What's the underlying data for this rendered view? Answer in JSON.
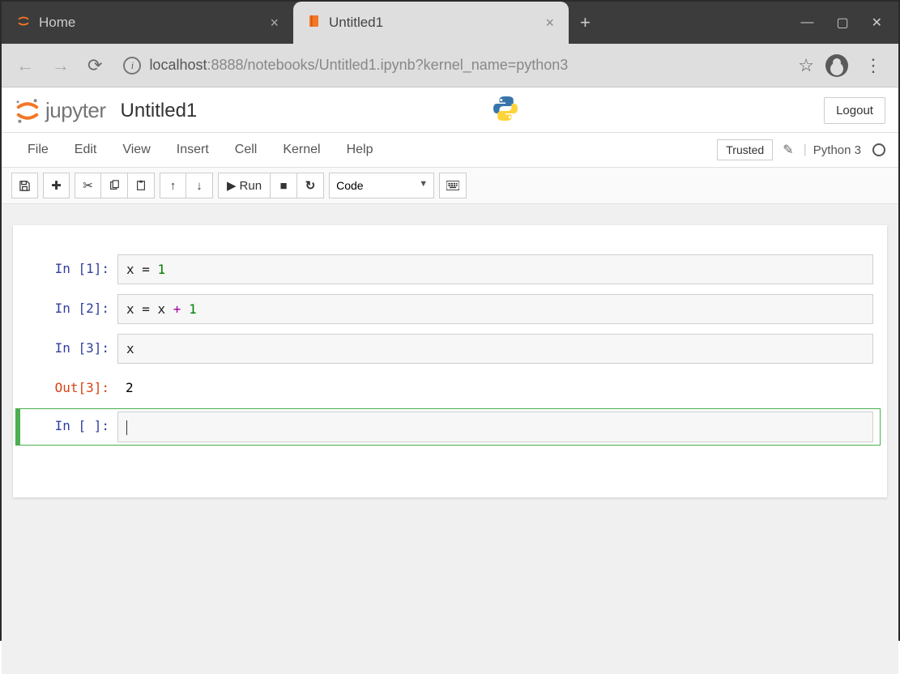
{
  "browser": {
    "tabs": {
      "inactive": {
        "title": "Home"
      },
      "active": {
        "title": "Untitled1"
      }
    },
    "url_host": "localhost",
    "url_port": ":8888",
    "url_path": "/notebooks/Untitled1.ipynb?kernel_name=python3"
  },
  "header": {
    "logo_text": "jupyter",
    "notebook_title": "Untitled1",
    "logout": "Logout"
  },
  "menubar": {
    "items": [
      "File",
      "Edit",
      "View",
      "Insert",
      "Cell",
      "Kernel",
      "Help"
    ],
    "trusted": "Trusted",
    "kernel_name": "Python 3"
  },
  "toolbar": {
    "run_label": "Run",
    "cell_type": "Code"
  },
  "cells": [
    {
      "prompt": "In [1]:",
      "code_html": "x = <span class='cm-num'>1</span>"
    },
    {
      "prompt": "In [2]:",
      "code_html": "x = x <span class='cm-op'>+</span> <span class='cm-num'>1</span>"
    },
    {
      "prompt": "In [3]:",
      "code_html": "x"
    },
    {
      "prompt_out": "Out[3]:",
      "output": "2"
    },
    {
      "prompt": "In [ ]:",
      "code_html": "<span class='cursor-caret'></span>",
      "selected": true
    }
  ]
}
